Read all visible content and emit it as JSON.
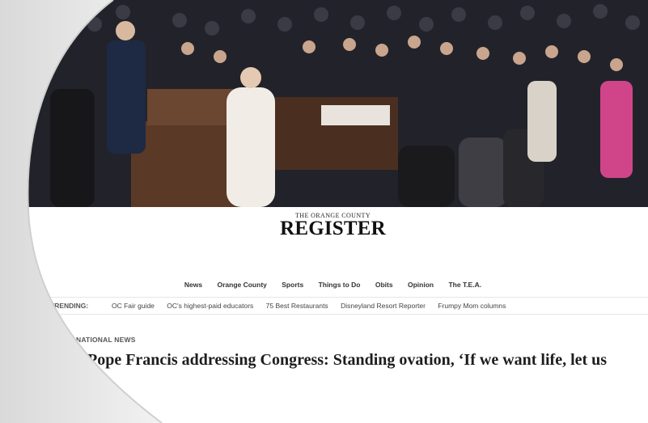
{
  "site": {
    "masthead_small": "THE ORANGE COUNTY",
    "masthead_name": "REGISTER"
  },
  "nav": {
    "items": [
      {
        "label": "News"
      },
      {
        "label": "Orange County"
      },
      {
        "label": "Sports"
      },
      {
        "label": "Things to Do"
      },
      {
        "label": "Obits"
      },
      {
        "label": "Opinion"
      },
      {
        "label": "The T.E.A."
      }
    ]
  },
  "trending": {
    "label": "TRENDING:",
    "links": [
      {
        "label": "OC Fair guide"
      },
      {
        "label": "OC's highest-paid educators"
      },
      {
        "label": "75 Best Restaurants"
      },
      {
        "label": "Disneyland Resort Reporter"
      },
      {
        "label": "Frumpy Mom columns"
      }
    ]
  },
  "article": {
    "section": "NATIONAL NEWS",
    "headline": "Pope Francis addressing Congress: Standing ovation, ‘If we want life, let us"
  },
  "colors": {
    "page_background": "#ededed",
    "site_background": "#ffffff",
    "headline": "#1e1e1e"
  }
}
